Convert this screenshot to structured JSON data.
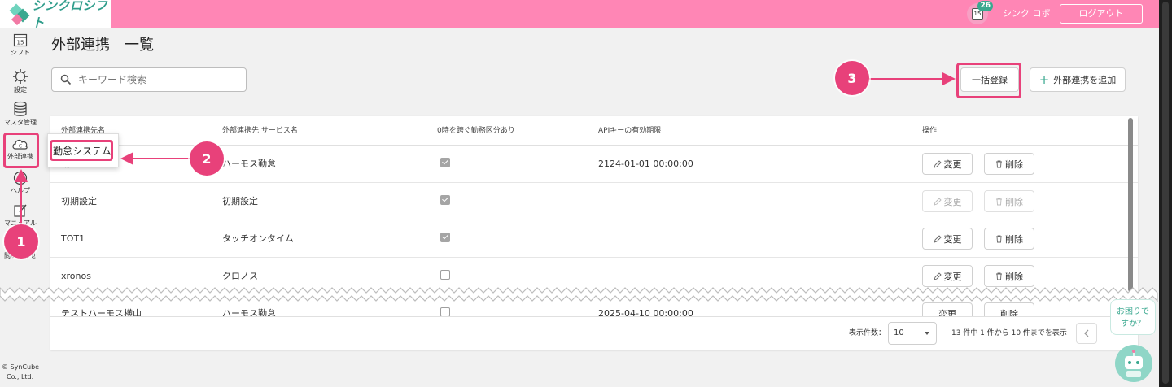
{
  "header": {
    "app_name": "シンクロシフト",
    "notification_count": "26",
    "calendar_day": "15",
    "user_name": "シンク ロボ",
    "logout_label": "ログアウト"
  },
  "sidebar": {
    "items": [
      {
        "label": "シフト",
        "icon": "calendar-icon",
        "icon_text": "15"
      },
      {
        "label": "設定",
        "icon": "gear-icon"
      },
      {
        "label": "マスタ管理",
        "icon": "database-icon"
      },
      {
        "label": "外部連携",
        "icon": "cloud-link-icon"
      },
      {
        "label": "ヘルプ",
        "icon": "help-icon"
      },
      {
        "label": "マニュアル",
        "icon": "manual-icon"
      },
      {
        "label": "問い合わせ",
        "icon": "mail-icon"
      }
    ],
    "copyright_line1": "© SynCube",
    "copyright_line2": "Co., Ltd."
  },
  "page": {
    "title": "外部連携　一覧",
    "search_placeholder": "キーワード検索",
    "bulk_register_label": "一括登録",
    "add_label": "外部連携を追加"
  },
  "table": {
    "headers": [
      "外部連携先名",
      "外部連携先 サービス名",
      "0時を跨ぐ勤務区分あり",
      "APIキーの有効期限",
      "操作"
    ],
    "edit_label": "変更",
    "delete_label": "削除",
    "rows": [
      {
        "name": "勤怠システム",
        "service": "ハーモス勤怠",
        "cross_midnight": true,
        "api_expiry": "2124-01-01 00:00:00",
        "actions_enabled": true
      },
      {
        "name": "初期設定",
        "service": "初期設定",
        "cross_midnight": true,
        "api_expiry": "",
        "actions_enabled": false
      },
      {
        "name": "TOT1",
        "service": "タッチオンタイム",
        "cross_midnight": true,
        "api_expiry": "",
        "actions_enabled": true
      },
      {
        "name": "xronos",
        "service": "クロノス",
        "cross_midnight": false,
        "api_expiry": "",
        "actions_enabled": true
      },
      {
        "name": "テストハーモス横山",
        "service": "ハーモス勤怠",
        "cross_midnight": false,
        "api_expiry": "2025-04-10 00:00:00",
        "actions_enabled": true
      }
    ]
  },
  "pagination": {
    "per_page_label": "表示件数：",
    "per_page_value": "10",
    "range_text": "13 件中 1 件から 10 件までを表示"
  },
  "annotations": {
    "tooltip_text": "勤怠システム",
    "steps": [
      "1",
      "2",
      "3"
    ],
    "accent_color": "#e8417a"
  },
  "help": {
    "bubble_text_1": "お困りで",
    "bubble_text_2": "すか？"
  },
  "colors": {
    "header_bg": "#ff86b5",
    "brand_green": "#3aa88f"
  }
}
